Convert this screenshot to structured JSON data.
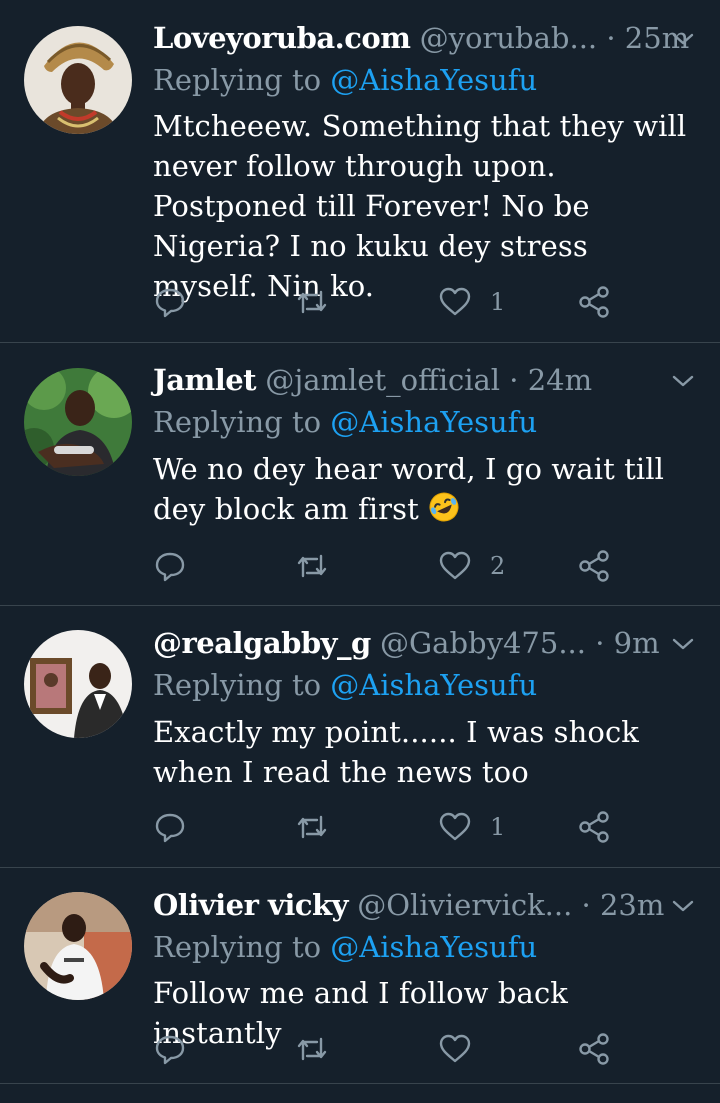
{
  "tweets": [
    {
      "name": "Loveyoruba.com",
      "handle": "@yorubab...",
      "dot": "·",
      "time": "25m",
      "replying_label": "Replying to",
      "replying_to": "@AishaYesufu",
      "text": "Mtcheeew. Something that they will never follow through upon. Postponed till Forever! No be Nigeria? I no kuku dey stress myself. Nin ko.",
      "like_count": "1",
      "avatar": "avatar-woman-gele"
    },
    {
      "name": "Jamlet",
      "handle": "@jamlet_official",
      "dot": "·",
      "time": "24m",
      "replying_label": "Replying to",
      "replying_to": "@AishaYesufu",
      "text": "We no dey hear word, I go wait till dey block am first",
      "emoji": "rolling-on-floor-laughing-emoji",
      "like_count": "2",
      "avatar": "avatar-man-outdoors"
    },
    {
      "name": "@realgabby_g",
      "handle": "@Gabby475...",
      "dot": "·",
      "time": "9m",
      "replying_label": "Replying to",
      "replying_to": "@AishaYesufu",
      "text": "Exactly my point...... I was shock when I read the news too",
      "like_count": "1",
      "avatar": "avatar-man-indoor-frame"
    },
    {
      "name": "Olivier vicky",
      "handle": "@Oliviervick...",
      "dot": "·",
      "time": "23m",
      "replying_label": "Replying to",
      "replying_to": "@AishaYesufu",
      "text": "Follow me and I follow back instantly",
      "like_count": "",
      "avatar": "avatar-man-white-shirt"
    }
  ],
  "icons": {
    "reply": "reply-icon",
    "retweet": "retweet-icon",
    "like": "like-icon",
    "share": "share-icon",
    "caret": "chevron-down-icon"
  },
  "colors": {
    "background": "#15202b",
    "divider": "#38444d",
    "secondary_text": "#8899a6",
    "accent": "#1da1f2",
    "primary_text": "#ffffff"
  }
}
